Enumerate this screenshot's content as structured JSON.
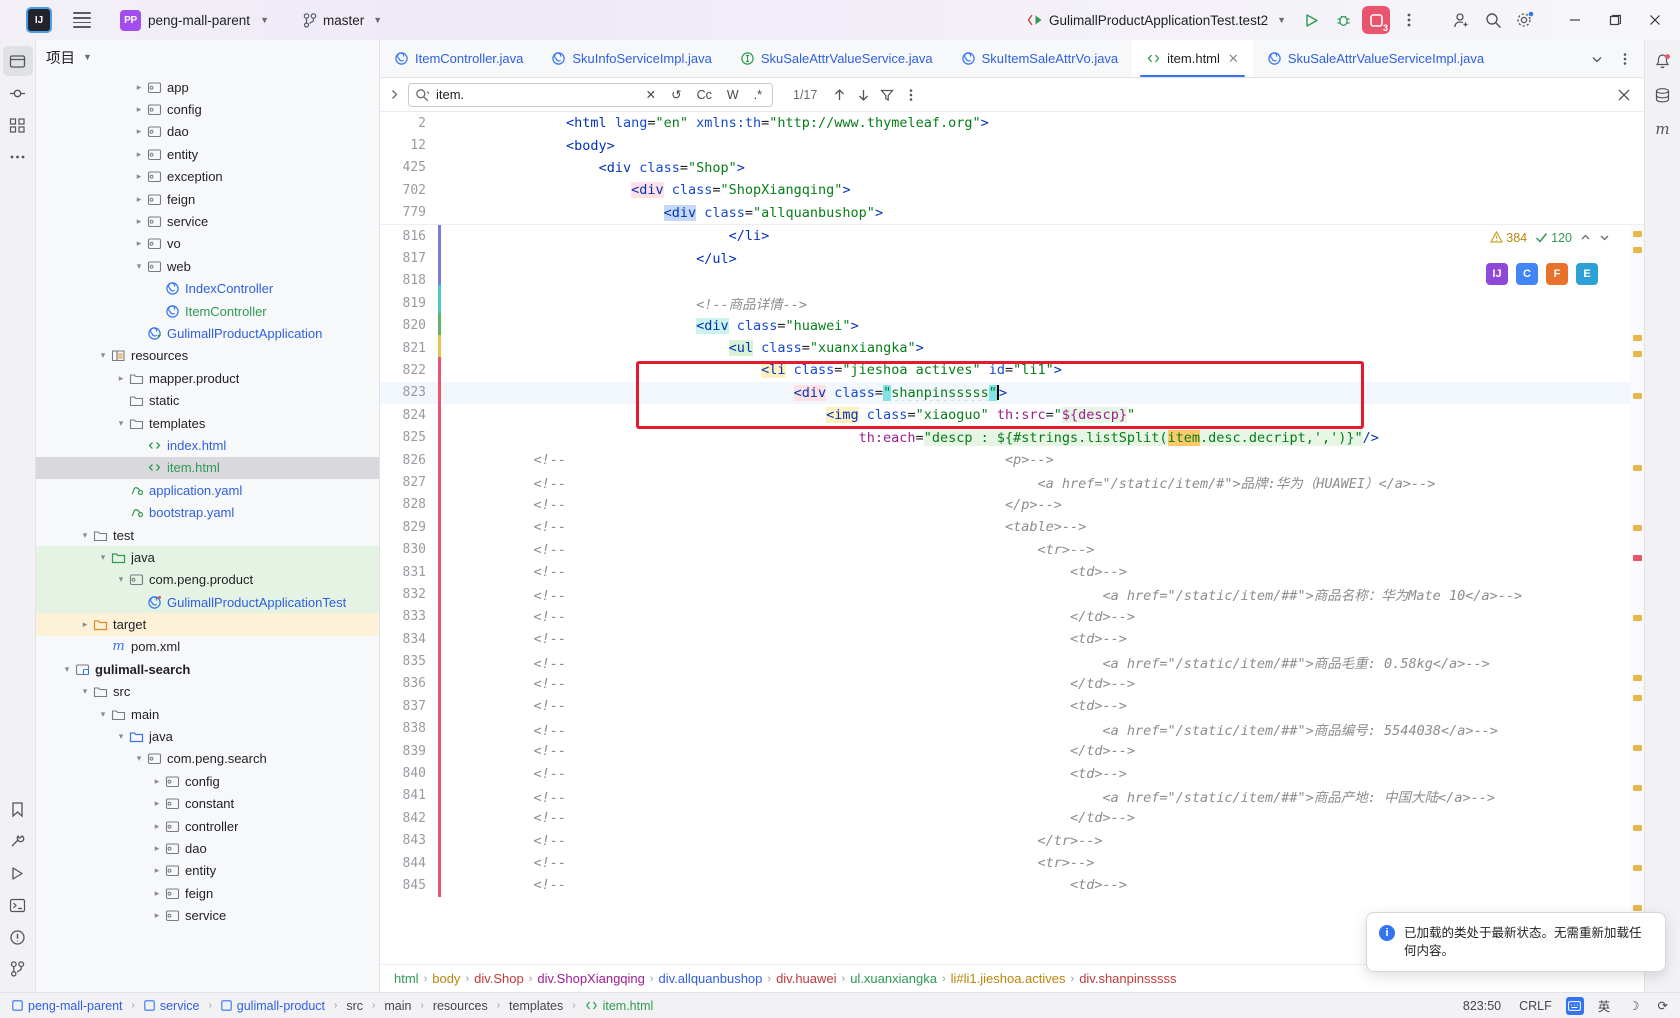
{
  "titlebar": {
    "project_name": "peng-mall-parent",
    "project_badge": "PP",
    "branch": "master",
    "run_config": "GulimallProductApplicationTest.test2",
    "run_badge": "3",
    "icons": [
      "menu-icon",
      "git-branch-icon",
      "run-icon",
      "debug-icon",
      "stop-icon",
      "more-icon",
      "account-icon",
      "search-icon",
      "settings-icon",
      "minimize-icon",
      "maximize-icon",
      "close-icon"
    ]
  },
  "project_panel": {
    "title": "项目",
    "tree": [
      {
        "indent": 5,
        "arrow": "right",
        "icon": "package",
        "label": "app",
        "color": "dark"
      },
      {
        "indent": 5,
        "arrow": "right",
        "icon": "package",
        "label": "config",
        "color": "dark"
      },
      {
        "indent": 5,
        "arrow": "right",
        "icon": "package",
        "label": "dao",
        "color": "dark"
      },
      {
        "indent": 5,
        "arrow": "right",
        "icon": "package",
        "label": "entity",
        "color": "dark"
      },
      {
        "indent": 5,
        "arrow": "right",
        "icon": "package",
        "label": "exception",
        "color": "dark"
      },
      {
        "indent": 5,
        "arrow": "right",
        "icon": "package",
        "label": "feign",
        "color": "dark"
      },
      {
        "indent": 5,
        "arrow": "right",
        "icon": "package",
        "label": "service",
        "color": "dark"
      },
      {
        "indent": 5,
        "arrow": "right",
        "icon": "package",
        "label": "vo",
        "color": "dark"
      },
      {
        "indent": 5,
        "arrow": "down",
        "icon": "package",
        "label": "web",
        "color": "dark"
      },
      {
        "indent": 6,
        "arrow": "none",
        "icon": "class",
        "label": "IndexController",
        "color": "blue"
      },
      {
        "indent": 6,
        "arrow": "none",
        "icon": "class",
        "label": "ItemController",
        "color": "green"
      },
      {
        "indent": 5,
        "arrow": "none",
        "icon": "springclass",
        "label": "GulimallProductApplication",
        "color": "blue"
      },
      {
        "indent": 3,
        "arrow": "down",
        "icon": "resources",
        "label": "resources",
        "color": "dark"
      },
      {
        "indent": 4,
        "arrow": "right",
        "icon": "folder",
        "label": "mapper.product",
        "color": "dark"
      },
      {
        "indent": 4,
        "arrow": "none",
        "icon": "folder",
        "label": "static",
        "color": "dark"
      },
      {
        "indent": 4,
        "arrow": "down",
        "icon": "folder",
        "label": "templates",
        "color": "dark"
      },
      {
        "indent": 5,
        "arrow": "none",
        "icon": "html",
        "label": "index.html",
        "color": "blue"
      },
      {
        "indent": 5,
        "arrow": "none",
        "icon": "html",
        "label": "item.html",
        "color": "green",
        "state": "selected"
      },
      {
        "indent": 4,
        "arrow": "none",
        "icon": "yaml",
        "label": "application.yaml",
        "color": "blue"
      },
      {
        "indent": 4,
        "arrow": "none",
        "icon": "yaml",
        "label": "bootstrap.yaml",
        "color": "blue"
      },
      {
        "indent": 2,
        "arrow": "down",
        "icon": "folder",
        "label": "test",
        "color": "dark"
      },
      {
        "indent": 3,
        "arrow": "down",
        "icon": "folder-green",
        "label": "java",
        "color": "dark",
        "state": "green"
      },
      {
        "indent": 4,
        "arrow": "down",
        "icon": "package",
        "label": "com.peng.product",
        "color": "dark",
        "state": "green"
      },
      {
        "indent": 5,
        "arrow": "none",
        "icon": "testclass",
        "label": "GulimallProductApplicationTest",
        "color": "blue",
        "state": "green"
      },
      {
        "indent": 2,
        "arrow": "right",
        "icon": "folder-orange",
        "label": "target",
        "color": "dark",
        "state": "amber"
      },
      {
        "indent": 3,
        "arrow": "none",
        "icon": "maven",
        "label": "pom.xml",
        "color": "dark"
      },
      {
        "indent": 1,
        "arrow": "down",
        "icon": "module",
        "label": "gulimall-search",
        "color": "dark",
        "bold": true
      },
      {
        "indent": 2,
        "arrow": "down",
        "icon": "folder",
        "label": "src",
        "color": "dark"
      },
      {
        "indent": 3,
        "arrow": "down",
        "icon": "folder",
        "label": "main",
        "color": "dark"
      },
      {
        "indent": 4,
        "arrow": "down",
        "icon": "folder-blue",
        "label": "java",
        "color": "dark"
      },
      {
        "indent": 5,
        "arrow": "down",
        "icon": "package",
        "label": "com.peng.search",
        "color": "dark"
      },
      {
        "indent": 6,
        "arrow": "right",
        "icon": "package",
        "label": "config",
        "color": "dark"
      },
      {
        "indent": 6,
        "arrow": "right",
        "icon": "package",
        "label": "constant",
        "color": "dark"
      },
      {
        "indent": 6,
        "arrow": "right",
        "icon": "package",
        "label": "controller",
        "color": "dark"
      },
      {
        "indent": 6,
        "arrow": "right",
        "icon": "package",
        "label": "dao",
        "color": "dark"
      },
      {
        "indent": 6,
        "arrow": "right",
        "icon": "package",
        "label": "entity",
        "color": "dark"
      },
      {
        "indent": 6,
        "arrow": "right",
        "icon": "package",
        "label": "feign",
        "color": "dark"
      },
      {
        "indent": 6,
        "arrow": "right",
        "icon": "package",
        "label": "service",
        "color": "dark"
      }
    ]
  },
  "tabs": [
    {
      "label": "ItemController.java",
      "icon": "class-icon",
      "active": false
    },
    {
      "label": "SkuInfoServiceImpl.java",
      "icon": "class-icon",
      "active": false
    },
    {
      "label": "SkuSaleAttrValueService.java",
      "icon": "interface-icon",
      "active": false
    },
    {
      "label": "SkuItemSaleAttrVo.java",
      "icon": "class-icon",
      "active": false
    },
    {
      "label": "item.html",
      "icon": "html-icon",
      "active": true
    },
    {
      "label": "SkuSaleAttrValueServiceImpl.java",
      "icon": "class-icon",
      "active": false
    }
  ],
  "find_bar": {
    "query": "item.",
    "match_count": "1/17",
    "options": [
      "Cc",
      "W",
      ".*"
    ],
    "icons": [
      "search-icon",
      "clear-icon",
      "regex-history-icon",
      "prev-match-icon",
      "next-match-icon",
      "filter-icon",
      "more-options-icon",
      "close-find-icon"
    ]
  },
  "sticky_lines": [
    {
      "num": "2",
      "indent": 2,
      "parts": [
        {
          "t": "<html",
          "c": "k-tag"
        },
        {
          "t": " lang",
          "c": "k-attr"
        },
        {
          "t": "=",
          "c": "k-punct"
        },
        {
          "t": "\"en\"",
          "c": "k-str"
        },
        {
          "t": " xmlns:th",
          "c": "k-attr"
        },
        {
          "t": "=",
          "c": "k-punct"
        },
        {
          "t": "\"http://www.thymeleaf.org\"",
          "c": "k-str"
        },
        {
          "t": ">",
          "c": "k-tag"
        }
      ]
    },
    {
      "num": "12",
      "indent": 2,
      "parts": [
        {
          "t": "<body>",
          "c": "k-tag"
        }
      ]
    },
    {
      "num": "425",
      "indent": 3,
      "parts": [
        {
          "t": "<div",
          "c": "k-tag"
        },
        {
          "t": " class",
          "c": "k-attr"
        },
        {
          "t": "=",
          "c": "k-punct"
        },
        {
          "t": "\"Shop\"",
          "c": "k-str"
        },
        {
          "t": ">",
          "c": "k-tag"
        }
      ]
    },
    {
      "num": "702",
      "indent": 4,
      "parts": [
        {
          "t": "<div",
          "c": "k-tag hi-pink"
        },
        {
          "t": " class",
          "c": "k-attr"
        },
        {
          "t": "=",
          "c": "k-punct"
        },
        {
          "t": "\"ShopXiangqing\"",
          "c": "k-str"
        },
        {
          "t": ">",
          "c": "k-tag"
        }
      ]
    },
    {
      "num": "779",
      "indent": 5,
      "parts": [
        {
          "t": "<div",
          "c": "k-tag hi-blue"
        },
        {
          "t": " class",
          "c": "k-attr"
        },
        {
          "t": "=",
          "c": "k-punct"
        },
        {
          "t": "\"allquanbushop\"",
          "c": "k-str"
        },
        {
          "t": ">",
          "c": "k-tag"
        }
      ]
    }
  ],
  "code_lines": [
    {
      "num": "816",
      "indent": 7,
      "clipped": true,
      "parts": [
        {
          "t": "</li>",
          "c": "k-tag"
        }
      ]
    },
    {
      "num": "817",
      "indent": 6,
      "parts": [
        {
          "t": "</ul>",
          "c": "k-tag"
        }
      ]
    },
    {
      "num": "818",
      "indent": 0,
      "parts": []
    },
    {
      "num": "819",
      "indent": 6,
      "parts": [
        {
          "t": "<!--商品详情-->",
          "c": "k-cmt"
        }
      ]
    },
    {
      "num": "820",
      "indent": 6,
      "parts": [
        {
          "t": "<div",
          "c": "k-tag hi-teal"
        },
        {
          "t": " class",
          "c": "k-attr"
        },
        {
          "t": "=",
          "c": "k-punct"
        },
        {
          "t": "\"huawei\"",
          "c": "k-str"
        },
        {
          "t": ">",
          "c": "k-tag"
        }
      ]
    },
    {
      "num": "821",
      "indent": 7,
      "parts": [
        {
          "t": "<ul",
          "c": "k-tag hi-lgreen"
        },
        {
          "t": " class",
          "c": "k-attr"
        },
        {
          "t": "=",
          "c": "k-punct"
        },
        {
          "t": "\"xuanxiangka\"",
          "c": "k-str squig"
        },
        {
          "t": ">",
          "c": "k-tag"
        }
      ]
    },
    {
      "num": "822",
      "indent": 8,
      "parts": [
        {
          "t": "<li",
          "c": "k-tag hi-yellow"
        },
        {
          "t": " class",
          "c": "k-attr"
        },
        {
          "t": "=",
          "c": "k-punct"
        },
        {
          "t": "\"jieshoa actives\"",
          "c": "k-str"
        },
        {
          "t": " id",
          "c": "k-attr"
        },
        {
          "t": "=",
          "c": "k-punct"
        },
        {
          "t": "\"li1\"",
          "c": "k-str"
        },
        {
          "t": ">",
          "c": "k-tag"
        }
      ]
    },
    {
      "num": "823",
      "indent": 9,
      "highlight": true,
      "parts": [
        {
          "t": "<div",
          "c": "k-tag hi-pink"
        },
        {
          "t": " class",
          "c": "k-attr"
        },
        {
          "t": "=",
          "c": "k-punct"
        },
        {
          "t": "\"",
          "c": "k-str hi-cyan"
        },
        {
          "t": "shanpinsssss",
          "c": "k-str squig"
        },
        {
          "t": "\"",
          "c": "k-str hi-cyan"
        },
        {
          "t": "CARET",
          "c": "caret"
        },
        {
          "t": ">",
          "c": "k-tag"
        }
      ]
    },
    {
      "num": "824",
      "indent": 10,
      "parts": [
        {
          "t": "<img",
          "c": "k-tag hi-yellow"
        },
        {
          "t": " class",
          "c": "k-attr"
        },
        {
          "t": "=",
          "c": "k-punct"
        },
        {
          "t": "\"xiaoguo\"",
          "c": "k-str squig"
        },
        {
          "t": " th:src",
          "c": "k-el"
        },
        {
          "t": "=",
          "c": "k-punct"
        },
        {
          "t": "\"",
          "c": "k-str"
        },
        {
          "t": "${descp}",
          "c": "k-el hi-green"
        },
        {
          "t": "\"",
          "c": "k-str"
        }
      ]
    },
    {
      "num": "825",
      "indent": 11,
      "parts": [
        {
          "t": "th:each",
          "c": "k-el"
        },
        {
          "t": "=",
          "c": "k-punct"
        },
        {
          "t": "\"descp : ${#strings.listSplit(",
          "c": "k-str hi-green"
        },
        {
          "t": "item",
          "c": "k-str hi-orange"
        },
        {
          "t": ".desc.decript,',')}\"",
          "c": "k-str hi-green"
        },
        {
          "t": "/>",
          "c": "k-tag"
        }
      ]
    },
    {
      "num": "826",
      "indent": 0,
      "cmt_prefix": true,
      "indent2": 11,
      "parts": [
        {
          "t": "<p>-->",
          "c": "k-cmt"
        }
      ]
    },
    {
      "num": "827",
      "indent": 0,
      "cmt_prefix": true,
      "indent2": 12,
      "parts": [
        {
          "t": "<a href=\"/static/item/#\">品牌:华为（HUAWEI）</a>-->",
          "c": "k-cmt"
        }
      ]
    },
    {
      "num": "828",
      "indent": 0,
      "cmt_prefix": true,
      "indent2": 11,
      "parts": [
        {
          "t": "</p>-->",
          "c": "k-cmt"
        }
      ]
    },
    {
      "num": "829",
      "indent": 0,
      "cmt_prefix": true,
      "indent2": 11,
      "parts": [
        {
          "t": "<table>-->",
          "c": "k-cmt"
        }
      ]
    },
    {
      "num": "830",
      "indent": 0,
      "cmt_prefix": true,
      "indent2": 12,
      "parts": [
        {
          "t": "<tr>-->",
          "c": "k-cmt"
        }
      ]
    },
    {
      "num": "831",
      "indent": 0,
      "cmt_prefix": true,
      "indent2": 13,
      "parts": [
        {
          "t": "<td>-->",
          "c": "k-cmt"
        }
      ]
    },
    {
      "num": "832",
      "indent": 0,
      "cmt_prefix": true,
      "indent2": 14,
      "parts": [
        {
          "t": "<a href=\"/static/item/##\">商品名称：华为Mate 10</a>-->",
          "c": "k-cmt"
        }
      ]
    },
    {
      "num": "833",
      "indent": 0,
      "cmt_prefix": true,
      "indent2": 13,
      "parts": [
        {
          "t": "</td>-->",
          "c": "k-cmt"
        }
      ]
    },
    {
      "num": "834",
      "indent": 0,
      "cmt_prefix": true,
      "indent2": 13,
      "parts": [
        {
          "t": "<td>-->",
          "c": "k-cmt"
        }
      ]
    },
    {
      "num": "835",
      "indent": 0,
      "cmt_prefix": true,
      "indent2": 14,
      "parts": [
        {
          "t": "<a href=\"/static/item/##\">商品毛重: 0.58kg</a>-->",
          "c": "k-cmt"
        }
      ]
    },
    {
      "num": "836",
      "indent": 0,
      "cmt_prefix": true,
      "indent2": 13,
      "parts": [
        {
          "t": "</td>-->",
          "c": "k-cmt"
        }
      ]
    },
    {
      "num": "837",
      "indent": 0,
      "cmt_prefix": true,
      "indent2": 13,
      "parts": [
        {
          "t": "<td>-->",
          "c": "k-cmt"
        }
      ]
    },
    {
      "num": "838",
      "indent": 0,
      "cmt_prefix": true,
      "indent2": 14,
      "parts": [
        {
          "t": "<a href=\"/static/item/##\">商品编号: 5544038</a>-->",
          "c": "k-cmt"
        }
      ]
    },
    {
      "num": "839",
      "indent": 0,
      "cmt_prefix": true,
      "indent2": 13,
      "parts": [
        {
          "t": "</td>-->",
          "c": "k-cmt"
        }
      ]
    },
    {
      "num": "840",
      "indent": 0,
      "cmt_prefix": true,
      "indent2": 13,
      "parts": [
        {
          "t": "<td>-->",
          "c": "k-cmt"
        }
      ]
    },
    {
      "num": "841",
      "indent": 0,
      "cmt_prefix": true,
      "indent2": 14,
      "parts": [
        {
          "t": "<a href=\"/static/item/##\">商品产地: 中国大陆</a>-->",
          "c": "k-cmt"
        }
      ]
    },
    {
      "num": "842",
      "indent": 0,
      "cmt_prefix": true,
      "indent2": 13,
      "parts": [
        {
          "t": "</td>-->",
          "c": "k-cmt"
        }
      ]
    },
    {
      "num": "843",
      "indent": 0,
      "cmt_prefix": true,
      "indent2": 12,
      "parts": [
        {
          "t": "</tr>-->",
          "c": "k-cmt"
        }
      ]
    },
    {
      "num": "844",
      "indent": 0,
      "cmt_prefix": true,
      "indent2": 12,
      "parts": [
        {
          "t": "<tr>-->",
          "c": "k-cmt"
        }
      ]
    },
    {
      "num": "845",
      "indent": 0,
      "cmt_prefix": true,
      "indent2": 13,
      "parts": [
        {
          "t": "<td>-->",
          "c": "k-cmt"
        }
      ]
    }
  ],
  "inspection": {
    "warnings": "384",
    "oks": "120"
  },
  "breadcrumbs": [
    {
      "label": "html",
      "color": "#2e9a52"
    },
    {
      "label": "body",
      "color": "#b8860b"
    },
    {
      "label": "div.Shop",
      "color": "#c23b3b"
    },
    {
      "label": "div.ShopXiangqing",
      "color": "#9d1f8f"
    },
    {
      "label": "div.allquanbushop",
      "color": "#2f5fe0"
    },
    {
      "label": "div.huawei",
      "color": "#c23b3b"
    },
    {
      "label": "ul.xuanxiangka",
      "color": "#2e9a52"
    },
    {
      "label": "li#li1.jieshoa.actives",
      "color": "#b8860b"
    },
    {
      "label": "div.shanpinsssss",
      "color": "#c23b3b"
    }
  ],
  "status_bar": {
    "path": [
      "peng-mall-parent",
      "service",
      "gulimall-product",
      "src",
      "main",
      "resources",
      "templates",
      "item.html"
    ],
    "caret_position": "823:50",
    "line_separator": "CRLF",
    "ime": "英",
    "icons": [
      "keyboard-icon",
      "ime-icon",
      "moon-icon",
      "refresh-icon"
    ]
  },
  "toast": {
    "message": "已加载的类处于最新状态。无需重新加载任何内容。",
    "icon": "info-icon"
  },
  "browser_icons": [
    {
      "name": "intellij-preview-icon",
      "color": "#8f48d8",
      "glyph": "IJ"
    },
    {
      "name": "chrome-icon",
      "color": "#4285f4",
      "glyph": "C"
    },
    {
      "name": "firefox-icon",
      "color": "#e8722c",
      "glyph": "F"
    },
    {
      "name": "edge-icon",
      "color": "#2f9fd8",
      "glyph": "E"
    }
  ],
  "left_rail_icons": [
    "project-icon",
    "commit-icon",
    "structure-icon",
    "more-tools-icon",
    "build-icon",
    "run-panel-icon",
    "terminal-icon",
    "problems-icon",
    "git-icon"
  ],
  "right_rail_icons": [
    "notifications-icon",
    "database-icon",
    "maven-icon"
  ]
}
